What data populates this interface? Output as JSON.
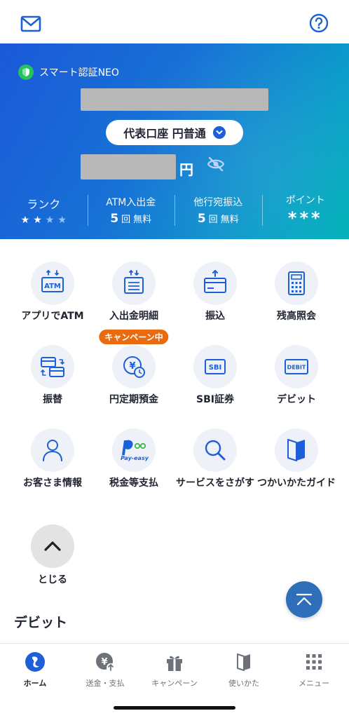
{
  "hero": {
    "auth_label": "スマート認証NEO",
    "account_label": "代表口座 円普通",
    "balance_unit": "円"
  },
  "stats": {
    "rank": {
      "label": "ランク",
      "stars_on": 2,
      "stars_total": 4
    },
    "atm": {
      "label": "ATM入出金",
      "count": "5",
      "unit": "回",
      "note": "無料"
    },
    "transfer": {
      "label": "他行宛振込",
      "count": "5",
      "unit": "回",
      "note": "無料"
    },
    "points": {
      "label": "ポイント",
      "value": "***"
    }
  },
  "grid": {
    "items": [
      {
        "label": "アプリでATM",
        "icon": "atm-app-icon"
      },
      {
        "label": "入出金明細",
        "icon": "statement-icon"
      },
      {
        "label": "振込",
        "icon": "transfer-icon"
      },
      {
        "label": "残高照会",
        "icon": "calculator-icon"
      },
      {
        "label": "振替",
        "icon": "card-swap-icon"
      },
      {
        "label": "円定期預金",
        "icon": "yen-deposit-icon",
        "badge": "キャンペーン中"
      },
      {
        "label": "SBI証券",
        "icon": "sbi-icon"
      },
      {
        "label": "デビット",
        "icon": "debit-icon"
      },
      {
        "label": "お客さま情報",
        "icon": "person-icon"
      },
      {
        "label": "税金等支払",
        "icon": "payeasy-icon"
      },
      {
        "label": "サービスをさがす",
        "icon": "search-icon"
      },
      {
        "label": "つかいかたガイド",
        "icon": "guide-book-icon"
      }
    ],
    "icon_text": {
      "atm": "ATM",
      "sbi": "SBI",
      "debit": "DEBIT",
      "yen": "¥",
      "payeasy": "Pay-easy"
    }
  },
  "close": {
    "label": "とじる"
  },
  "section": {
    "title": "デビット"
  },
  "nav": {
    "items": [
      {
        "label": "ホーム",
        "active": true
      },
      {
        "label": "送金・支払"
      },
      {
        "label": "キャンペーン"
      },
      {
        "label": "使いかた"
      },
      {
        "label": "メニュー"
      }
    ]
  },
  "colors": {
    "brand_blue": "#1b58d8",
    "accent_orange": "#ea6a10",
    "teal": "#00b3b8"
  }
}
